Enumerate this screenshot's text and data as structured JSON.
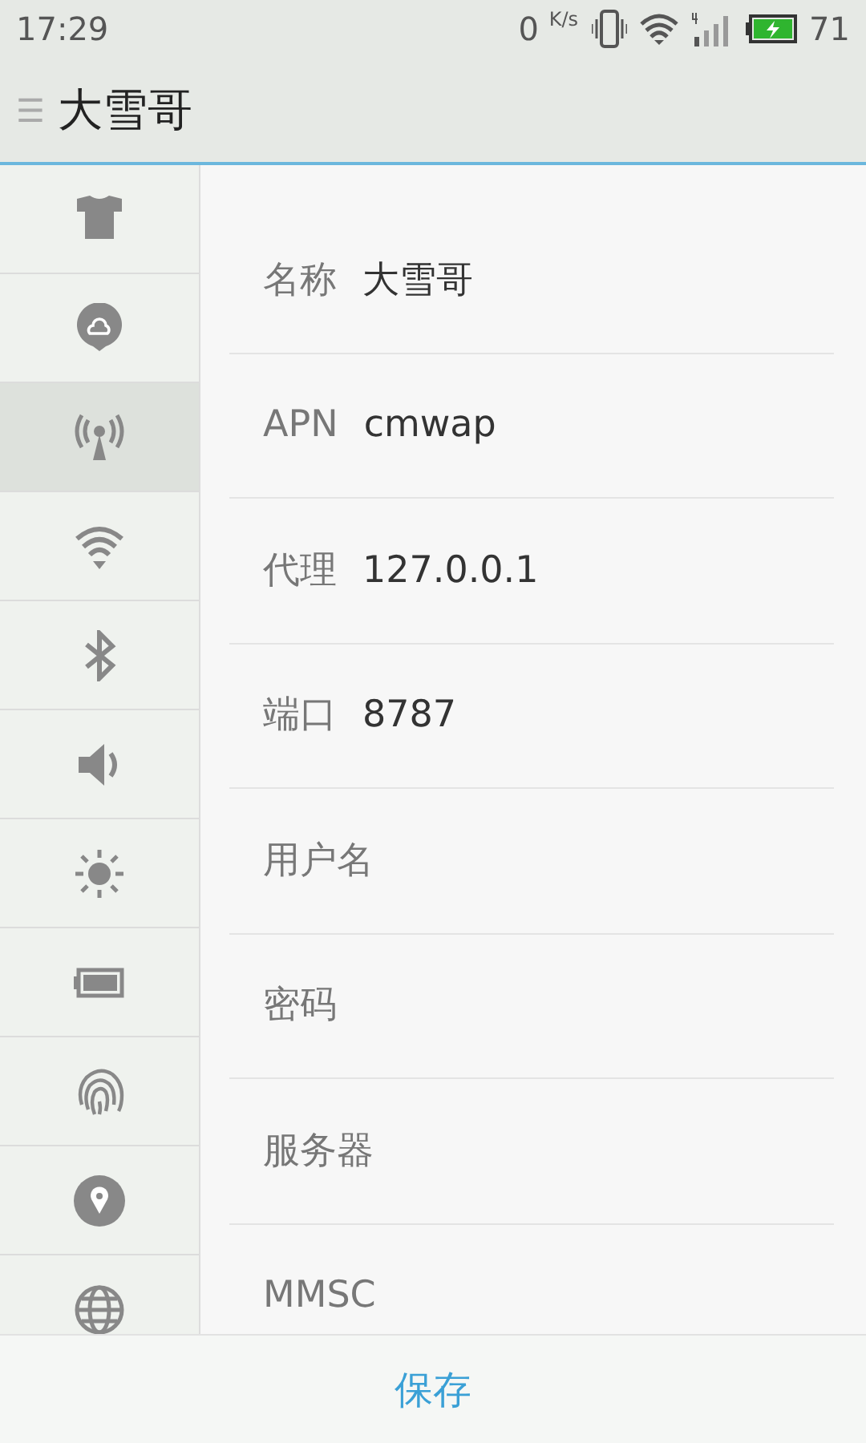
{
  "status_bar": {
    "time": "17:29",
    "net_speed": "0",
    "net_unit": "K/s",
    "battery_level": "71"
  },
  "header": {
    "menu_glyph": "☰",
    "title": "大雪哥"
  },
  "sidebar": {
    "items": [
      {
        "kind": "shirt",
        "selected": false
      },
      {
        "kind": "cloud",
        "selected": false
      },
      {
        "kind": "antenna",
        "selected": true
      },
      {
        "kind": "wifi",
        "selected": false
      },
      {
        "kind": "bluetooth",
        "selected": false
      },
      {
        "kind": "speaker",
        "selected": false
      },
      {
        "kind": "sun",
        "selected": false
      },
      {
        "kind": "battery",
        "selected": false
      },
      {
        "kind": "fingerprint",
        "selected": false
      },
      {
        "kind": "location",
        "selected": false
      },
      {
        "kind": "globe",
        "selected": false
      }
    ]
  },
  "fields": [
    {
      "label": "名称",
      "value": "大雪哥"
    },
    {
      "label": "APN",
      "value": "cmwap"
    },
    {
      "label": "代理",
      "value": "127.0.0.1"
    },
    {
      "label": "端口",
      "value": "8787"
    },
    {
      "label": "用户名"
    },
    {
      "label": "密码"
    },
    {
      "label": "服务器"
    },
    {
      "label": "MMSC"
    }
  ],
  "footer": {
    "save_button": "保存"
  }
}
